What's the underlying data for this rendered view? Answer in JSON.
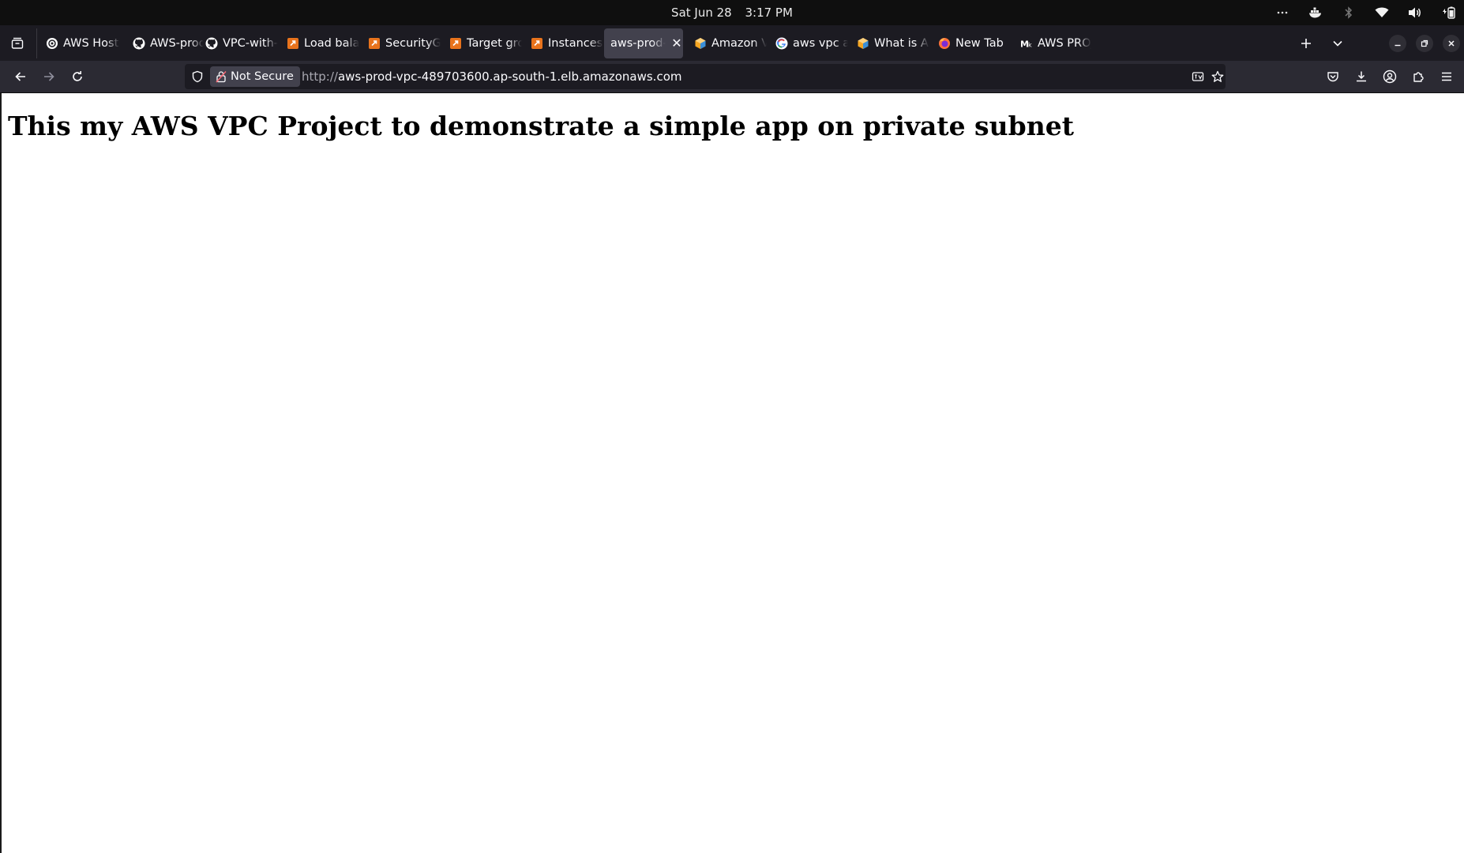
{
  "system": {
    "date": "Sat Jun 28",
    "time": "3:17 PM",
    "tray_icons": [
      "more-icon",
      "docker-icon",
      "bluetooth-icon",
      "wifi-icon",
      "volume-icon",
      "battery-icon"
    ]
  },
  "tabs": [
    {
      "title": "AWS Hostin",
      "icon": "medium-icon"
    },
    {
      "title": "AWS-prod-le",
      "icon": "github-icon"
    },
    {
      "title": "VPC-with-se",
      "icon": "github-icon"
    },
    {
      "title": "Load balanc",
      "icon": "aws-console-icon"
    },
    {
      "title": "SecurityGro",
      "icon": "aws-console-icon"
    },
    {
      "title": "Target grou",
      "icon": "aws-console-icon"
    },
    {
      "title": "Instances | E",
      "icon": "aws-console-icon"
    },
    {
      "title": "aws-prod-vpc",
      "icon": "none",
      "active": true
    },
    {
      "title": "Amazon Virt",
      "icon": "aws-docs-icon"
    },
    {
      "title": "aws vpc arch",
      "icon": "google-icon"
    },
    {
      "title": "What is Ama",
      "icon": "aws-docs-icon"
    },
    {
      "title": "New Tab",
      "icon": "firefox-icon"
    },
    {
      "title": "AWS PROJE",
      "icon": "medium-icon"
    }
  ],
  "toolbar": {
    "security_label": "Not Secure",
    "url_scheme": "http://",
    "url_host": "aws-prod-vpc-489703600.ap-south-1.elb.amazonaws.com"
  },
  "page": {
    "heading": "This my AWS VPC Project to demonstrate a simple app on private subnet"
  },
  "colors": {
    "topbar": "#0f0f0f",
    "tabstrip": "#1c1b22",
    "toolbar": "#2b2a33",
    "active_tab": "#42414d",
    "aws_orange": "#e8731c"
  }
}
